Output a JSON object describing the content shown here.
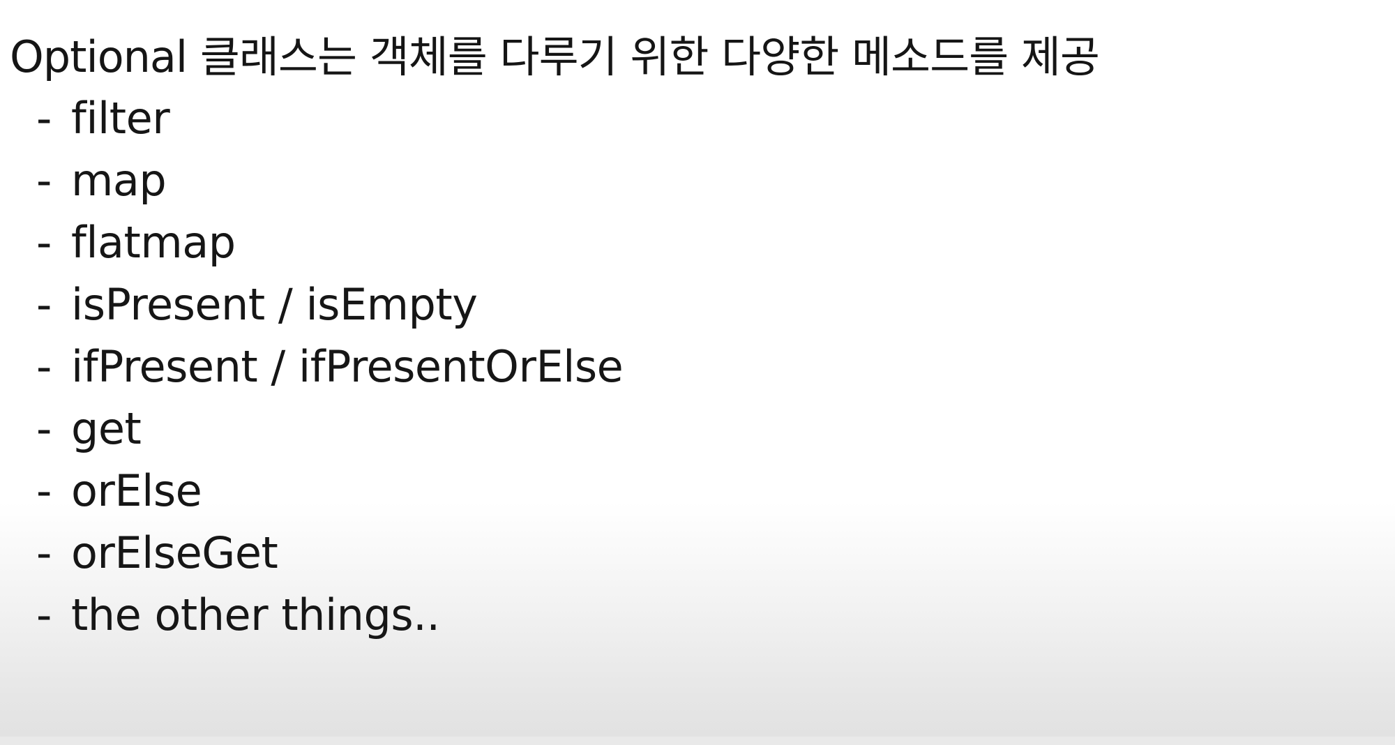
{
  "slide": {
    "title": "Optional 클래스는 객체를 다루기 위한 다양한 메소드를 제공",
    "methods": [
      {
        "dash": "-",
        "label": "filter"
      },
      {
        "dash": "-",
        "label": "map"
      },
      {
        "dash": "-",
        "label": "flatmap"
      },
      {
        "dash": "-",
        "label": "isPresent / isEmpty"
      },
      {
        "dash": "-",
        "label": "ifPresent / ifPresentOrElse"
      },
      {
        "dash": "-",
        "label": "get"
      },
      {
        "dash": "-",
        "label": "orElse"
      },
      {
        "dash": "-",
        "label": "orElseGet"
      },
      {
        "dash": "-",
        "label": "the other things.."
      }
    ]
  },
  "colors": {
    "text": "#1a1a1a",
    "background_top": "#ffffff",
    "background_bottom": "#e1e1e1"
  }
}
